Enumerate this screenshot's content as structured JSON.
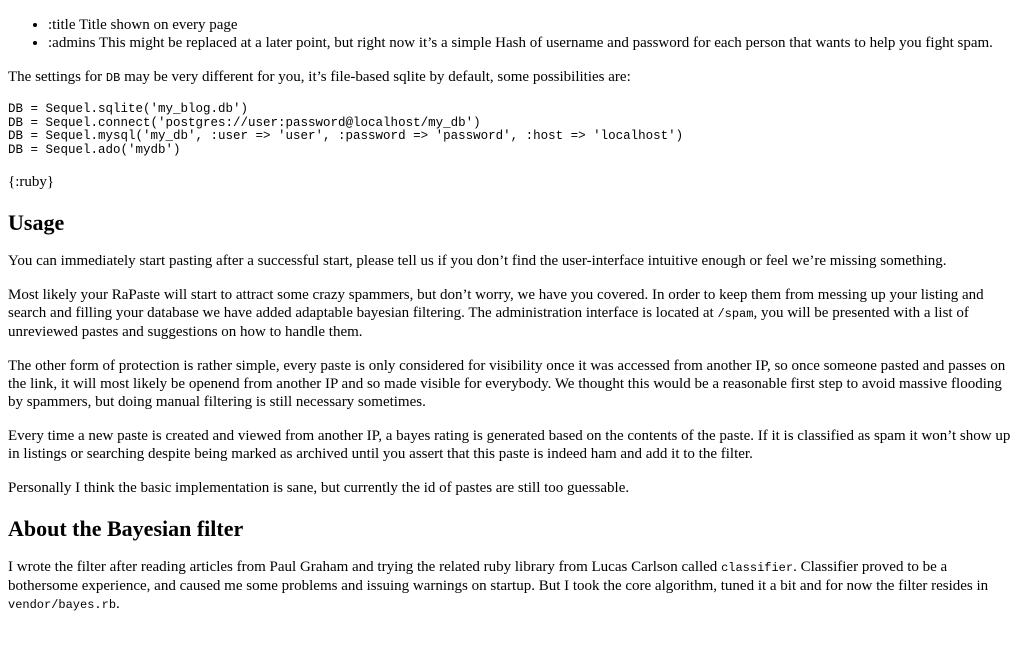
{
  "settings_list": [
    ":title Title shown on every page",
    ":admins This might be replaced at a later point, but right now it’s a simple Hash of username and password for each person that wants to help you fight spam."
  ],
  "db_intro": {
    "before": "The settings for ",
    "code": "DB",
    "after": " may be very different for you, it’s file-based sqlite by default, some possibilities are:"
  },
  "code_block": "DB = Sequel.sqlite('my_blog.db')\nDB = Sequel.connect('postgres://user:password@localhost/my_db')\nDB = Sequel.mysql('my_db', :user => 'user', :password => 'password', :host => 'localhost')\nDB = Sequel.ado('mydb')",
  "ruby_marker": "{:ruby}",
  "usage": {
    "heading": "Usage",
    "p1": "You can immediately start pasting after a successful start, please tell us if you don’t find the user-interface intuitive enough or feel we’re missing something.",
    "p2_before": "Most likely your RaPaste will start to attract some crazy spammers, but don’t worry, we have you covered. In order to keep them from messing up your listing and search and filling your database we have added adaptable bayesian filtering. The administration interface is located at ",
    "p2_code": "/spam",
    "p2_after": ", you will be presented with a list of unreviewed pastes and suggestions on how to handle them.",
    "p3": "The other form of protection is rather simple, every paste is only considered for visibility once it was accessed from another IP, so once someone pasted and passes on the link, it will most likely be openend from another IP and so made visible for everybody. We thought this would be a reasonable first step to avoid massive flooding by spammers, but doing manual filtering is still necessary sometimes.",
    "p4": "Every time a new paste is created and viewed from another IP, a bayes rating is generated based on the contents of the paste. If it is classified as spam it won’t show up in listings or searching despite being marked as archived until you assert that this paste is indeed ham and add it to the filter.",
    "p5": "Personally I think the basic implementation is sane, but currently the id of pastes are still too guessable."
  },
  "bayes": {
    "heading": "About the Bayesian filter",
    "p1_before": "I wrote the filter after reading articles from Paul Graham and trying the related ruby library from Lucas Carlson called ",
    "p1_code1": "classifier",
    "p1_middle": ". Classifier proved to be a bothersome experience, and caused me some problems and issuing warnings on startup. But I took the core algorithm, tuned it a bit and for now the filter resides in ",
    "p1_code2": "vendor/bayes.rb",
    "p1_after": "."
  }
}
